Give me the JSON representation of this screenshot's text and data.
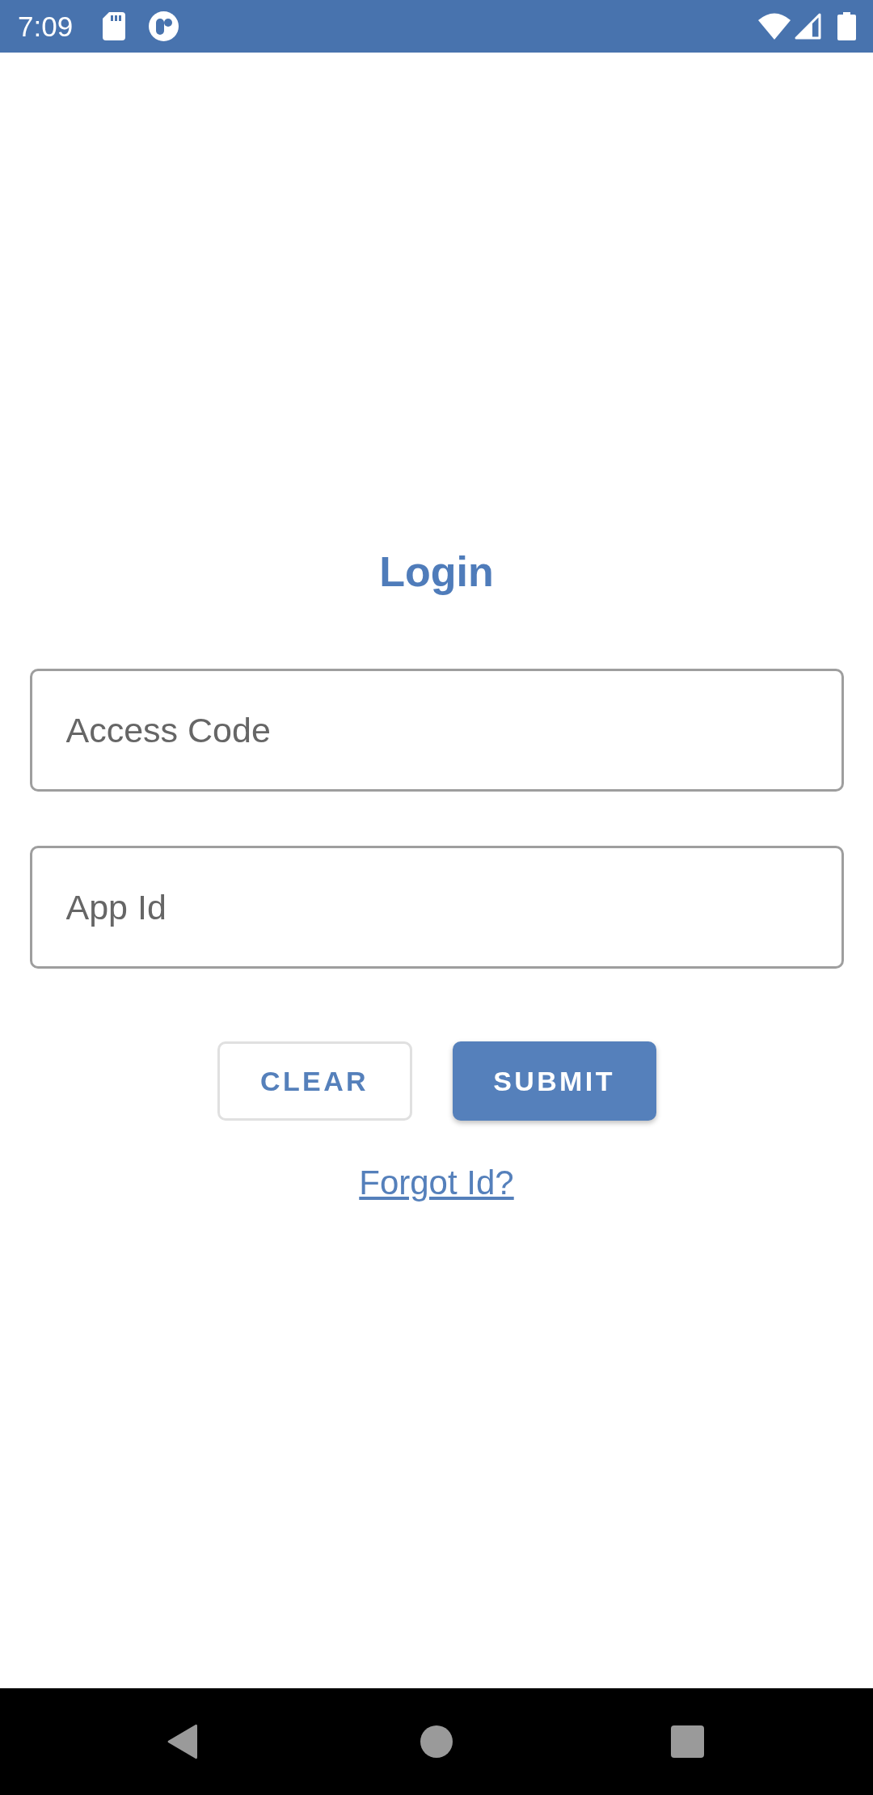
{
  "status_bar": {
    "time": "7:09"
  },
  "login": {
    "title": "Login",
    "fields": [
      {
        "placeholder": "Access Code"
      },
      {
        "placeholder": "App Id"
      }
    ],
    "buttons": [
      {
        "label": "CLEAR",
        "kind": "outlined"
      },
      {
        "label": "SUBMIT",
        "kind": "filled"
      }
    ],
    "link": "Forgot Id?"
  }
}
